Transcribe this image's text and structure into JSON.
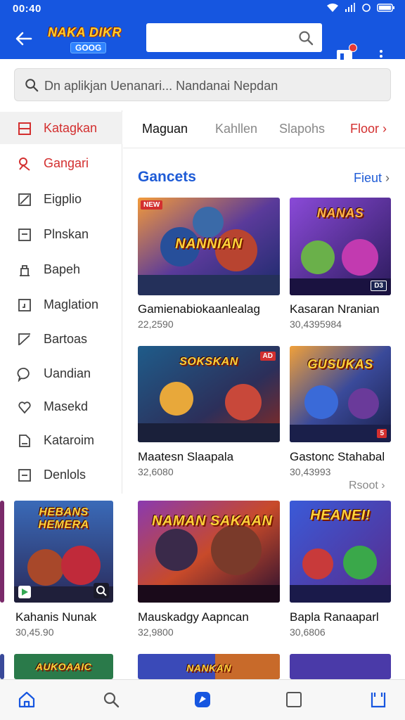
{
  "status_bar": {
    "time": "00:40"
  },
  "app_bar": {
    "logo_line1": "NAKA DIKR",
    "logo_line2": "GOOG"
  },
  "search": {
    "placeholder": "Dn aplikjan Uenanari... Nandanai Nepdan"
  },
  "sidebar": {
    "items": [
      {
        "label": "Katagkan",
        "icon": "category-icon"
      },
      {
        "label": "Gangari",
        "icon": "gamepad-icon"
      },
      {
        "label": "Eigplio",
        "icon": "edit-icon"
      },
      {
        "label": "Plnskan",
        "icon": "document-icon"
      },
      {
        "label": "Bapeh",
        "icon": "building-icon"
      },
      {
        "label": "Maglation",
        "icon": "book-icon"
      },
      {
        "label": "Bartoas",
        "icon": "pencil-icon"
      },
      {
        "label": "Uandian",
        "icon": "chat-icon"
      },
      {
        "label": "Masekd",
        "icon": "heart-icon"
      },
      {
        "label": "Kataroim",
        "icon": "note-icon"
      },
      {
        "label": "Denlols",
        "icon": "minus-box-icon"
      }
    ]
  },
  "tabs": [
    {
      "label": "Maguan"
    },
    {
      "label": "Kahllen"
    },
    {
      "label": "Slapohs"
    },
    {
      "label": "Floor"
    }
  ],
  "section": {
    "title": "Gancets",
    "link": "Fieut",
    "more_link": "Rsoot"
  },
  "cards": [
    {
      "name": "Gamienabiokaanlealag",
      "count": "22,2590",
      "art_title": "NANNIAN",
      "badge": "NEW"
    },
    {
      "name": "Kasaran Nranian",
      "count": "30,4395984",
      "art_title": "NANAS",
      "badge": "D3"
    },
    {
      "name": "Maatesn Slaapala",
      "count": "32,6080",
      "art_title": "SOKSKAN",
      "badge": "AD"
    },
    {
      "name": "Gastonc Stahabal",
      "count": "30,43993",
      "art_title": "GUSUKAS",
      "badge": "5"
    },
    {
      "name": "Kahanis Nunak",
      "count": "30,45.90",
      "art_title": "HEBANS HEMERA",
      "badge": ""
    },
    {
      "name": "Mauskadgy Aapncan",
      "count": "32,9800",
      "art_title": "NAMAN SAKAAN",
      "badge": ""
    },
    {
      "name": "Bapla Ranaaparl",
      "count": "30,6806",
      "art_title": "HEANEI!",
      "badge": ""
    },
    {
      "name": "",
      "count": "",
      "art_title": "AUKOAAIC",
      "badge": ""
    },
    {
      "name": "",
      "count": "",
      "art_title": "NANKAN",
      "badge": ""
    },
    {
      "name": "",
      "count": "",
      "art_title": "",
      "badge": ""
    }
  ],
  "bottom_nav": [
    {
      "icon": "home-icon"
    },
    {
      "icon": "search-icon"
    },
    {
      "icon": "apps-icon"
    },
    {
      "icon": "square-icon"
    },
    {
      "icon": "library-icon"
    }
  ],
  "colors": {
    "brand": "#1656e0",
    "accent_red": "#d32f2f",
    "link_blue": "#1e5bd6"
  }
}
